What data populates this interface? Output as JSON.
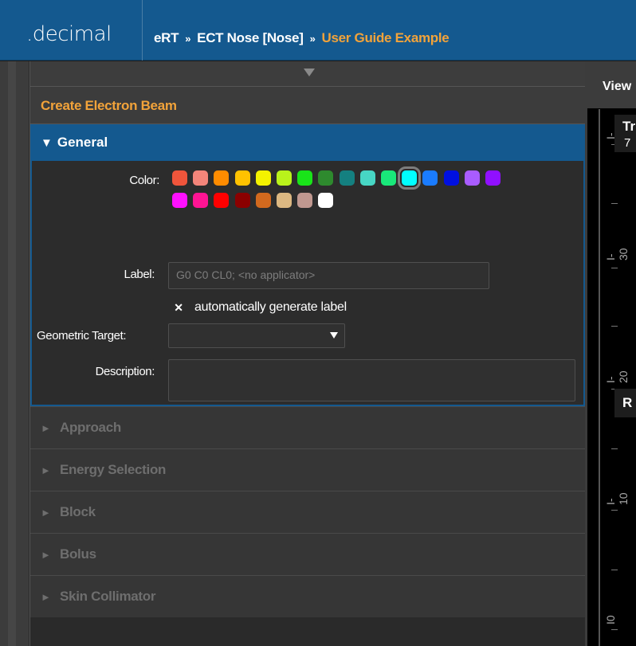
{
  "app": {
    "logo": ".decimal"
  },
  "breadcrumb": {
    "items": [
      "eRT",
      "ECT Nose [Nose]",
      "User Guide Example"
    ],
    "separator": "»"
  },
  "panel": {
    "title": "Create Electron Beam",
    "general": {
      "header": "General",
      "color_label": "Color:",
      "colors": [
        "#f0553b",
        "#f4857a",
        "#ff8c00",
        "#ffc200",
        "#f4f200",
        "#b9f21b",
        "#19e419",
        "#2e8a2e",
        "#148080",
        "#47d6c4",
        "#19e87a",
        "#00ffff",
        "#1a7cff",
        "#0010e0",
        "#a95cff",
        "#9010ff",
        "#ff10ff",
        "#ff1493",
        "#ff0000",
        "#8b0000",
        "#d2691e",
        "#dcb882",
        "#c09890",
        "#ffffff"
      ],
      "selected_color_index": 11,
      "label_label": "Label:",
      "label_placeholder": "G0 C0 CL0;  <no applicator>",
      "auto_label": "automatically generate label",
      "auto_label_checked": true,
      "geometric_target_label": "Geometric Target:",
      "geometric_target_value": "",
      "description_label": "Description:",
      "description_value": ""
    },
    "sections": [
      {
        "label": "Approach"
      },
      {
        "label": "Energy Selection"
      },
      {
        "label": "Block"
      },
      {
        "label": "Bolus"
      },
      {
        "label": "Skin Collimator"
      }
    ]
  },
  "view": {
    "header": "View",
    "ruler_labels": [
      "I-40",
      "I-30",
      "I-20",
      "I-10",
      "I0"
    ],
    "overlay_top_title": "Tr",
    "overlay_top_value": "7",
    "overlay_mid": "R"
  }
}
